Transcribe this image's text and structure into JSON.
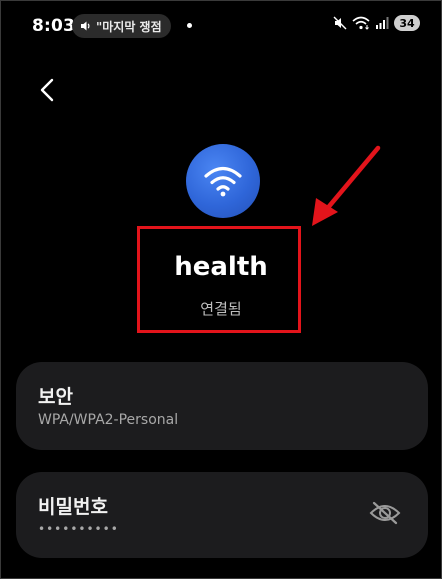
{
  "status_bar": {
    "time": "8:03",
    "media_text": "\"마지막 쟁점",
    "battery": "34"
  },
  "network": {
    "ssid": "health",
    "status": "연결됨"
  },
  "security": {
    "label": "보안",
    "value": "WPA/WPA2-Personal"
  },
  "password": {
    "label": "비밀번호",
    "masked_value": "••••••••••"
  },
  "icons": {
    "back": "chevron-left-icon",
    "wifi": "wifi-icon",
    "visibility": "eye-off-icon"
  },
  "colors": {
    "background": "#000000",
    "card": "#1c1c1e",
    "wifi_accent": "#2f66d9",
    "annotation": "#e3141b"
  }
}
